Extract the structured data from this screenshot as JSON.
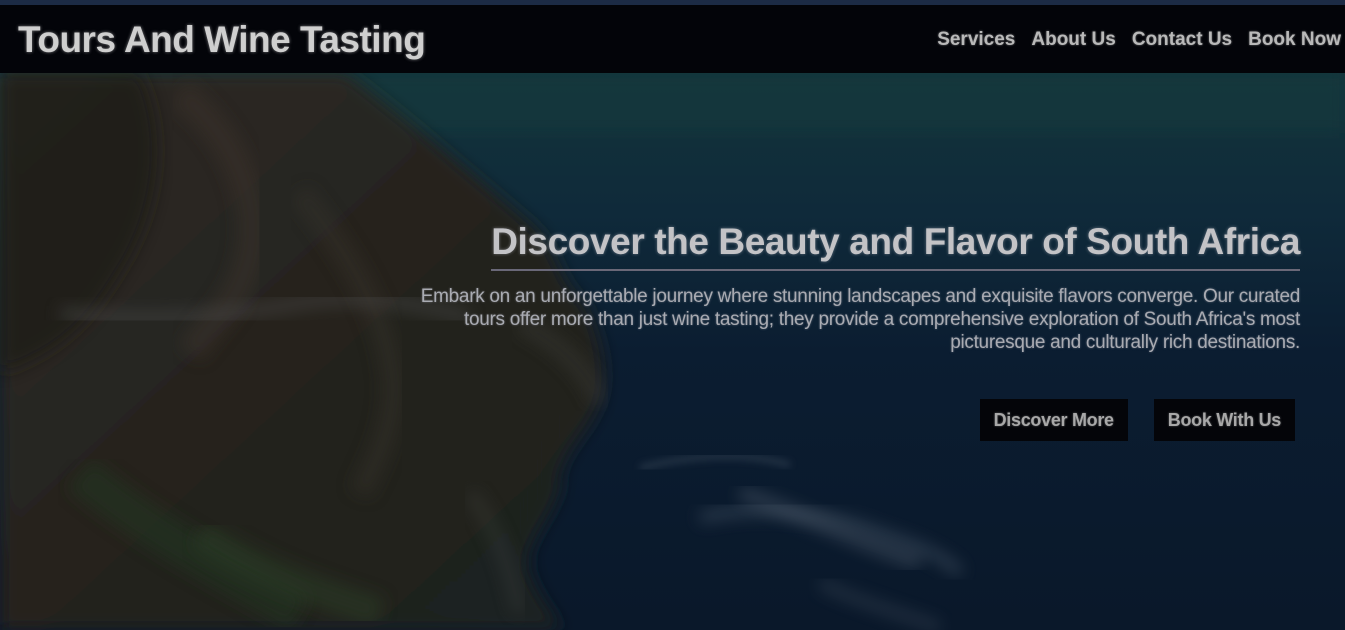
{
  "header": {
    "brand": "Tours And Wine Tasting",
    "nav": [
      {
        "label": "Services"
      },
      {
        "label": "About Us"
      },
      {
        "label": "Contact Us"
      },
      {
        "label": "Book Now"
      }
    ]
  },
  "hero": {
    "title": "Discover the Beauty and Flavor of South Africa",
    "description": "Embark on an unforgettable journey where stunning landscapes and exquisite flavors converge. Our curated tours offer more than just wine tasting; they provide a comprehensive exploration of South Africa's most picturesque and culturally rich destinations.",
    "buttons": [
      {
        "label": "Discover More"
      },
      {
        "label": "Book With Us"
      }
    ]
  },
  "colors": {
    "navbar": "#030409",
    "ocean": "#0b1a2c",
    "cliff": "#2a2623"
  }
}
